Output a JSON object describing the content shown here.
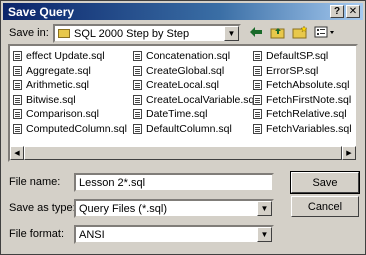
{
  "dialog": {
    "title": "Save Query",
    "help_button": "?",
    "close_button": "✕"
  },
  "save_in": {
    "label": "Save in:",
    "value": "SQL 2000 Step by Step"
  },
  "toolbar": {
    "icons": [
      "back-arrow-icon",
      "up-folder-icon",
      "new-folder-icon",
      "view-menu-icon"
    ]
  },
  "files": {
    "columns": [
      [
        "effect Update.sql",
        "Aggregate.sql",
        "Arithmetic.sql",
        "Bitwise.sql",
        "Comparison.sql",
        "ComputedColumn.sql"
      ],
      [
        "Concatenation.sql",
        "CreateGlobal.sql",
        "CreateLocal.sql",
        "CreateLocalVariable.sql",
        "DateTime.sql",
        "DefaultColumn.sql"
      ],
      [
        "DefaultSP.sql",
        "ErrorSP.sql",
        "FetchAbsolute.sql",
        "FetchFirstNote.sql",
        "FetchRelative.sql",
        "FetchVariables.sql"
      ]
    ]
  },
  "file_name": {
    "label": "File name:",
    "value": "Lesson 2*.sql"
  },
  "save_as_type": {
    "label": "Save as type:",
    "value": "Query Files (*.sql)"
  },
  "file_format": {
    "label": "File format:",
    "value": "ANSI"
  },
  "buttons": {
    "save": "Save",
    "cancel": "Cancel"
  }
}
